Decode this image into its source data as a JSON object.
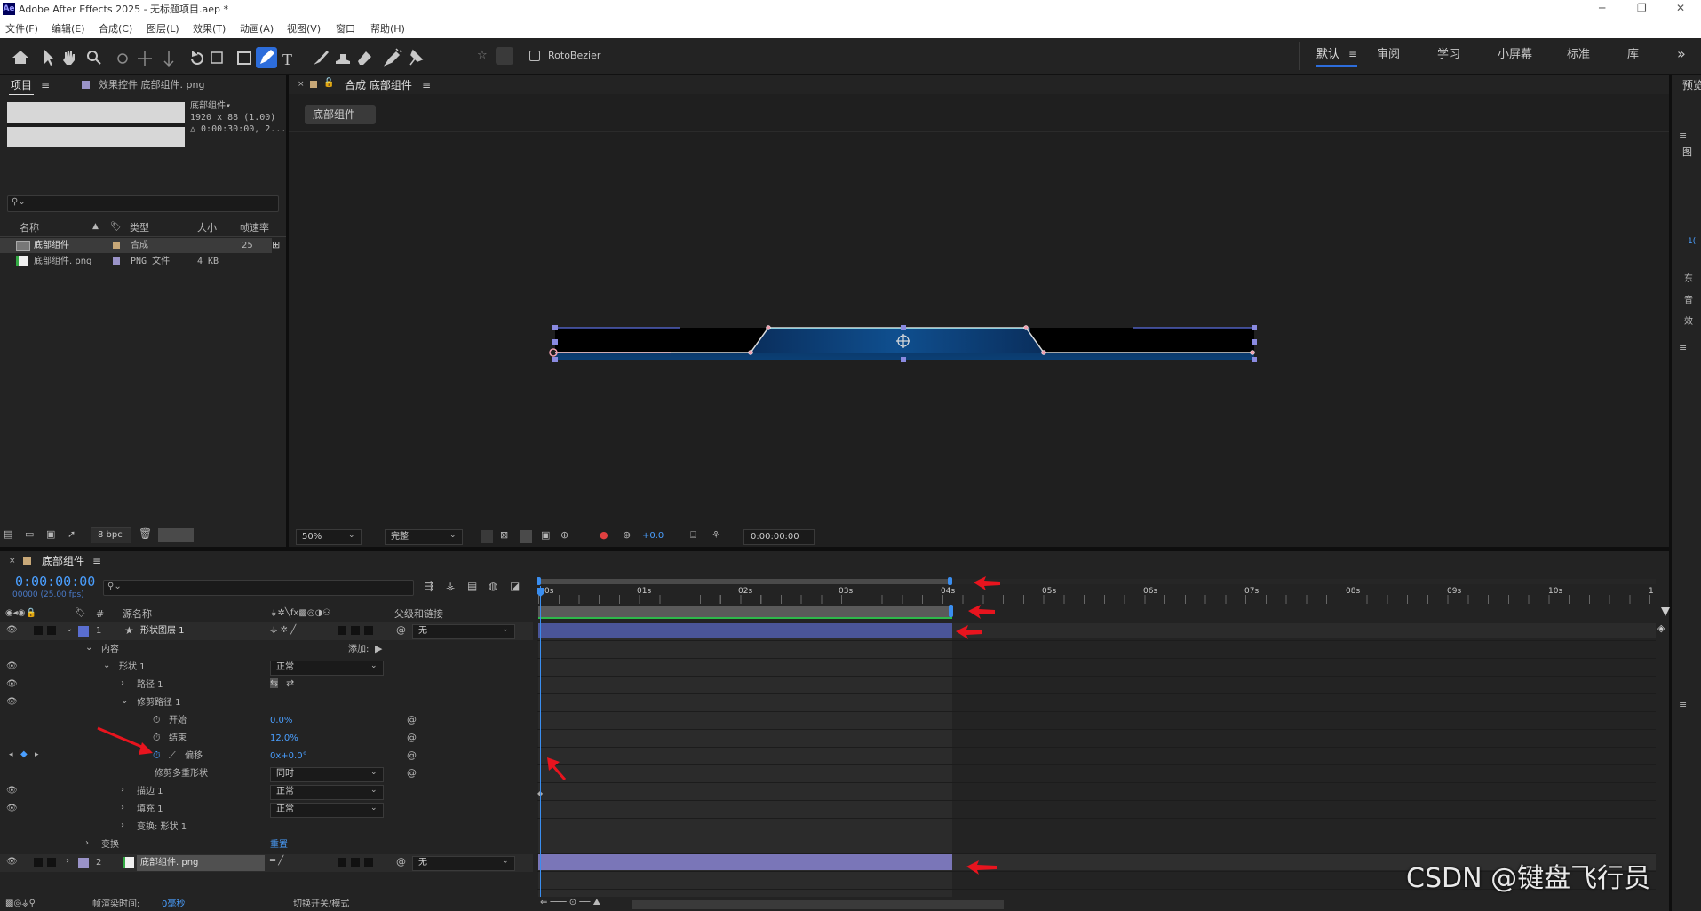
{
  "app": {
    "title": "Adobe After Effects 2025 - 无标题项目.aep *",
    "icon_label": "Ae",
    "menu": [
      "文件(F)",
      "编辑(E)",
      "合成(C)",
      "图层(L)",
      "效果(T)",
      "动画(A)",
      "视图(V)",
      "窗口",
      "帮助(H)"
    ]
  },
  "toolbar": {
    "rotobezier_label": "RotoBezier",
    "workspaces": [
      "默认",
      "审阅",
      "学习",
      "小屏幕",
      "标准",
      "库"
    ],
    "overflow": "»",
    "right_cut": "预览"
  },
  "project_panel": {
    "tab_project": "项目",
    "tab_effects": "效果控件 底部组件. png",
    "info_name": "底部组件▾",
    "info_size": "1920 x 88 (1.00)",
    "info_duration": "△ 0:00:30:00, 2...",
    "search_placeholder": "",
    "col_name": "名称",
    "col_type": "类型",
    "col_size": "大小",
    "col_fps": "帧速率",
    "items": [
      {
        "name": "底部组件",
        "type": "合成",
        "size": "",
        "fps": "25"
      },
      {
        "name": "底部组件. png",
        "type": "PNG 文件",
        "size": "4 KB",
        "fps": ""
      }
    ],
    "bpc": "8 bpc"
  },
  "comp_panel": {
    "tab_label": "合成 底部组件",
    "breadcrumb": "底部组件",
    "zoom": "50%",
    "quality": "完整",
    "exposure": "+0.0",
    "timecode": "0:00:00:00"
  },
  "right_panel": {
    "items": [
      "≡",
      "图",
      "1(",
      "东",
      "音",
      "效",
      "≡",
      "≡"
    ]
  },
  "timeline": {
    "tab_label": "底部组件",
    "timecode": "0:00:00:00",
    "fps_label": "00000 (25.00 fps)",
    "col_source": "源名称",
    "col_parent": "父级和链接",
    "ruler": [
      "0s",
      "01s",
      "02s",
      "03s",
      "04s",
      "05s",
      "06s",
      "07s",
      "08s",
      "09s",
      "10s",
      "1"
    ],
    "layers": [
      {
        "num": "1",
        "name": "形状图层 1",
        "parent": "无"
      },
      {
        "num": "2",
        "name": "底部组件. png",
        "parent": "无"
      }
    ],
    "props": {
      "contents": "内容",
      "add": "添加:",
      "shape1": "形状 1",
      "shape1_mode": "正常",
      "path1": "路径 1",
      "trim": "修剪路径 1",
      "start": "开始",
      "start_val": "0.0%",
      "end": "结束",
      "end_val": "12.0%",
      "offset": "偏移",
      "offset_val": "0x+0.0°",
      "trim_multi": "修剪多重形状",
      "trim_multi_val": "同时",
      "stroke1": "描边 1",
      "stroke1_mode": "正常",
      "fill1": "填充 1",
      "fill1_mode": "正常",
      "transform_shape": "变换: 形状 1",
      "transform": "变换",
      "reset": "重置"
    },
    "footer_render_label": "帧渲染时间:",
    "footer_render_value": "0毫秒",
    "footer_toggle": "切换开关/模式"
  },
  "watermark": "CSDN @键盘飞行员",
  "colors": {
    "accent_blue": "#4a9fff",
    "layer_bar": "#4a5598",
    "red_arrow": "#e8141e"
  }
}
